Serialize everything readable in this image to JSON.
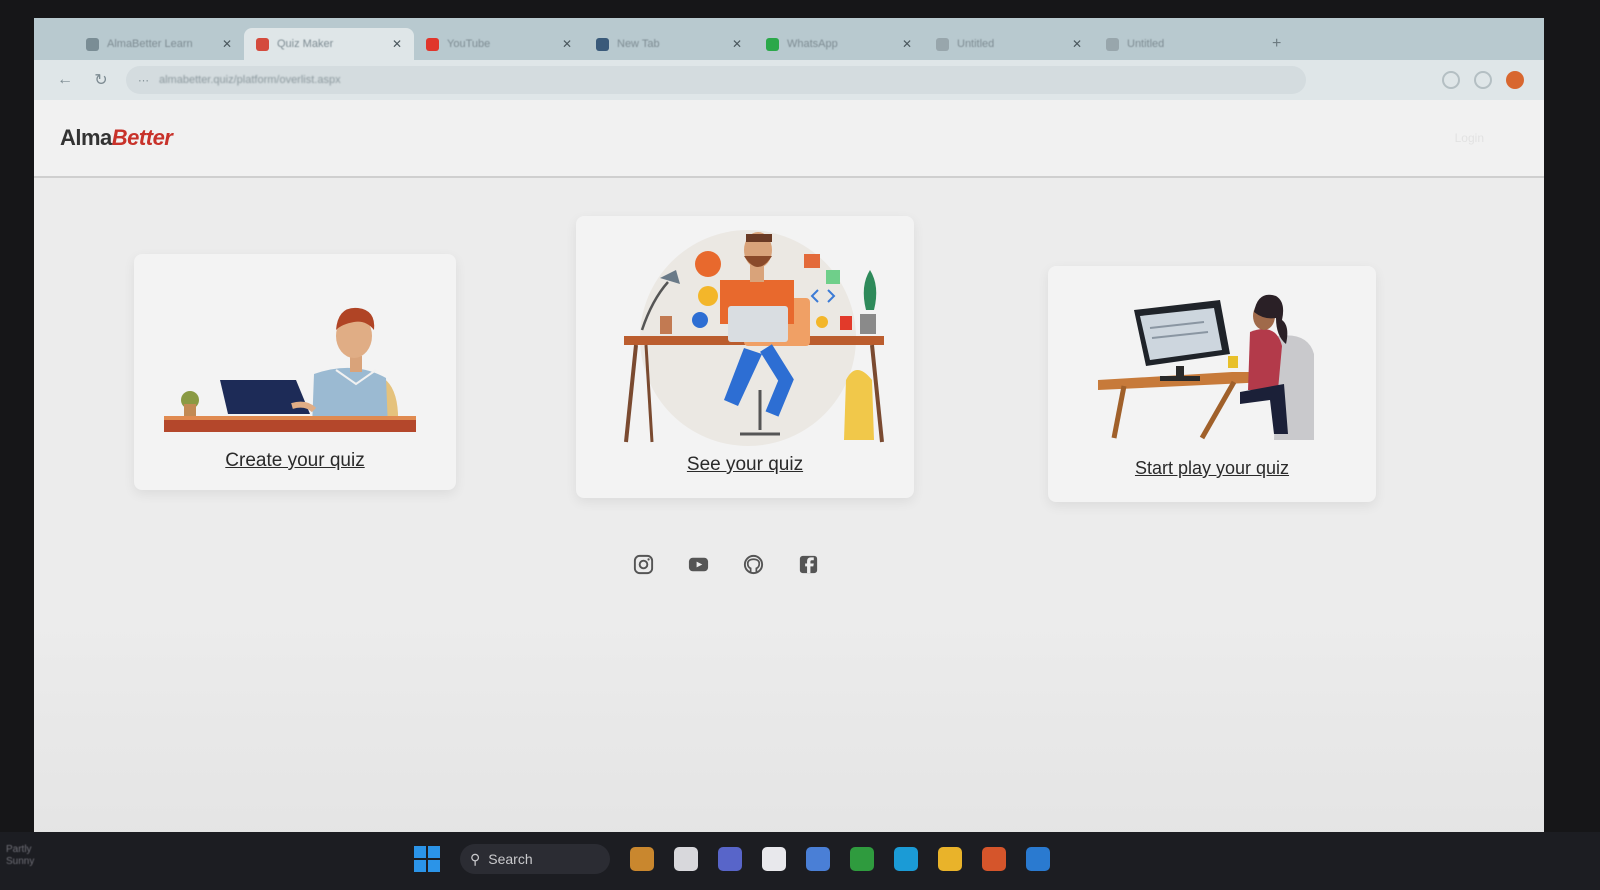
{
  "browser": {
    "tabs": [
      {
        "title": "AlmaBetter Learn",
        "favicon_color": "#7a8d95",
        "active": false
      },
      {
        "title": "Quiz Maker",
        "favicon_color": "#d44b3d",
        "active": true
      },
      {
        "title": "YouTube",
        "favicon_color": "#e0352b",
        "active": false
      },
      {
        "title": "New Tab",
        "favicon_color": "#3a5a7a",
        "active": false
      },
      {
        "title": "WhatsApp",
        "favicon_color": "#2ba84a",
        "active": false
      },
      {
        "title": "Untitled",
        "favicon_color": "#98a6ac",
        "active": false
      },
      {
        "title": "Untitled",
        "favicon_color": "#98a6ac",
        "active": false
      }
    ],
    "new_tab_label": "+",
    "url": "almabetter.quiz/platform/overlist.aspx",
    "icons": {
      "back": "arrow-left-icon",
      "reload": "reload-icon",
      "tune": "site-info-icon"
    }
  },
  "site": {
    "logo_text_a": "Alma",
    "logo_text_b": "Better",
    "header_right": "Login",
    "cards": [
      {
        "label": "Create your quiz"
      },
      {
        "label": "See your quiz"
      },
      {
        "label": "Start play your quiz"
      }
    ],
    "social": [
      "instagram-icon",
      "youtube-icon",
      "github-icon",
      "facebook-icon"
    ]
  },
  "taskbar": {
    "weather_line1": "Partly",
    "weather_line2": "Sunny",
    "search_label": "Search",
    "apps": [
      {
        "name": "widgets-icon",
        "color": "#c9872e"
      },
      {
        "name": "task-view-icon",
        "color": "#d8d8dc"
      },
      {
        "name": "teams-icon",
        "color": "#5865c9"
      },
      {
        "name": "store-icon",
        "color": "#e8e8ec"
      },
      {
        "name": "chrome-icon",
        "color": "#4a7fd6"
      },
      {
        "name": "xbox-icon",
        "color": "#2f9b3e"
      },
      {
        "name": "edge-icon",
        "color": "#1b9bd6"
      },
      {
        "name": "explorer-icon",
        "color": "#e9b32a"
      },
      {
        "name": "media-icon",
        "color": "#d5552b"
      },
      {
        "name": "vscode-icon",
        "color": "#2a7ad0"
      }
    ]
  },
  "colors": {
    "accent": "#c8322a",
    "page_bg": "#ececec"
  }
}
